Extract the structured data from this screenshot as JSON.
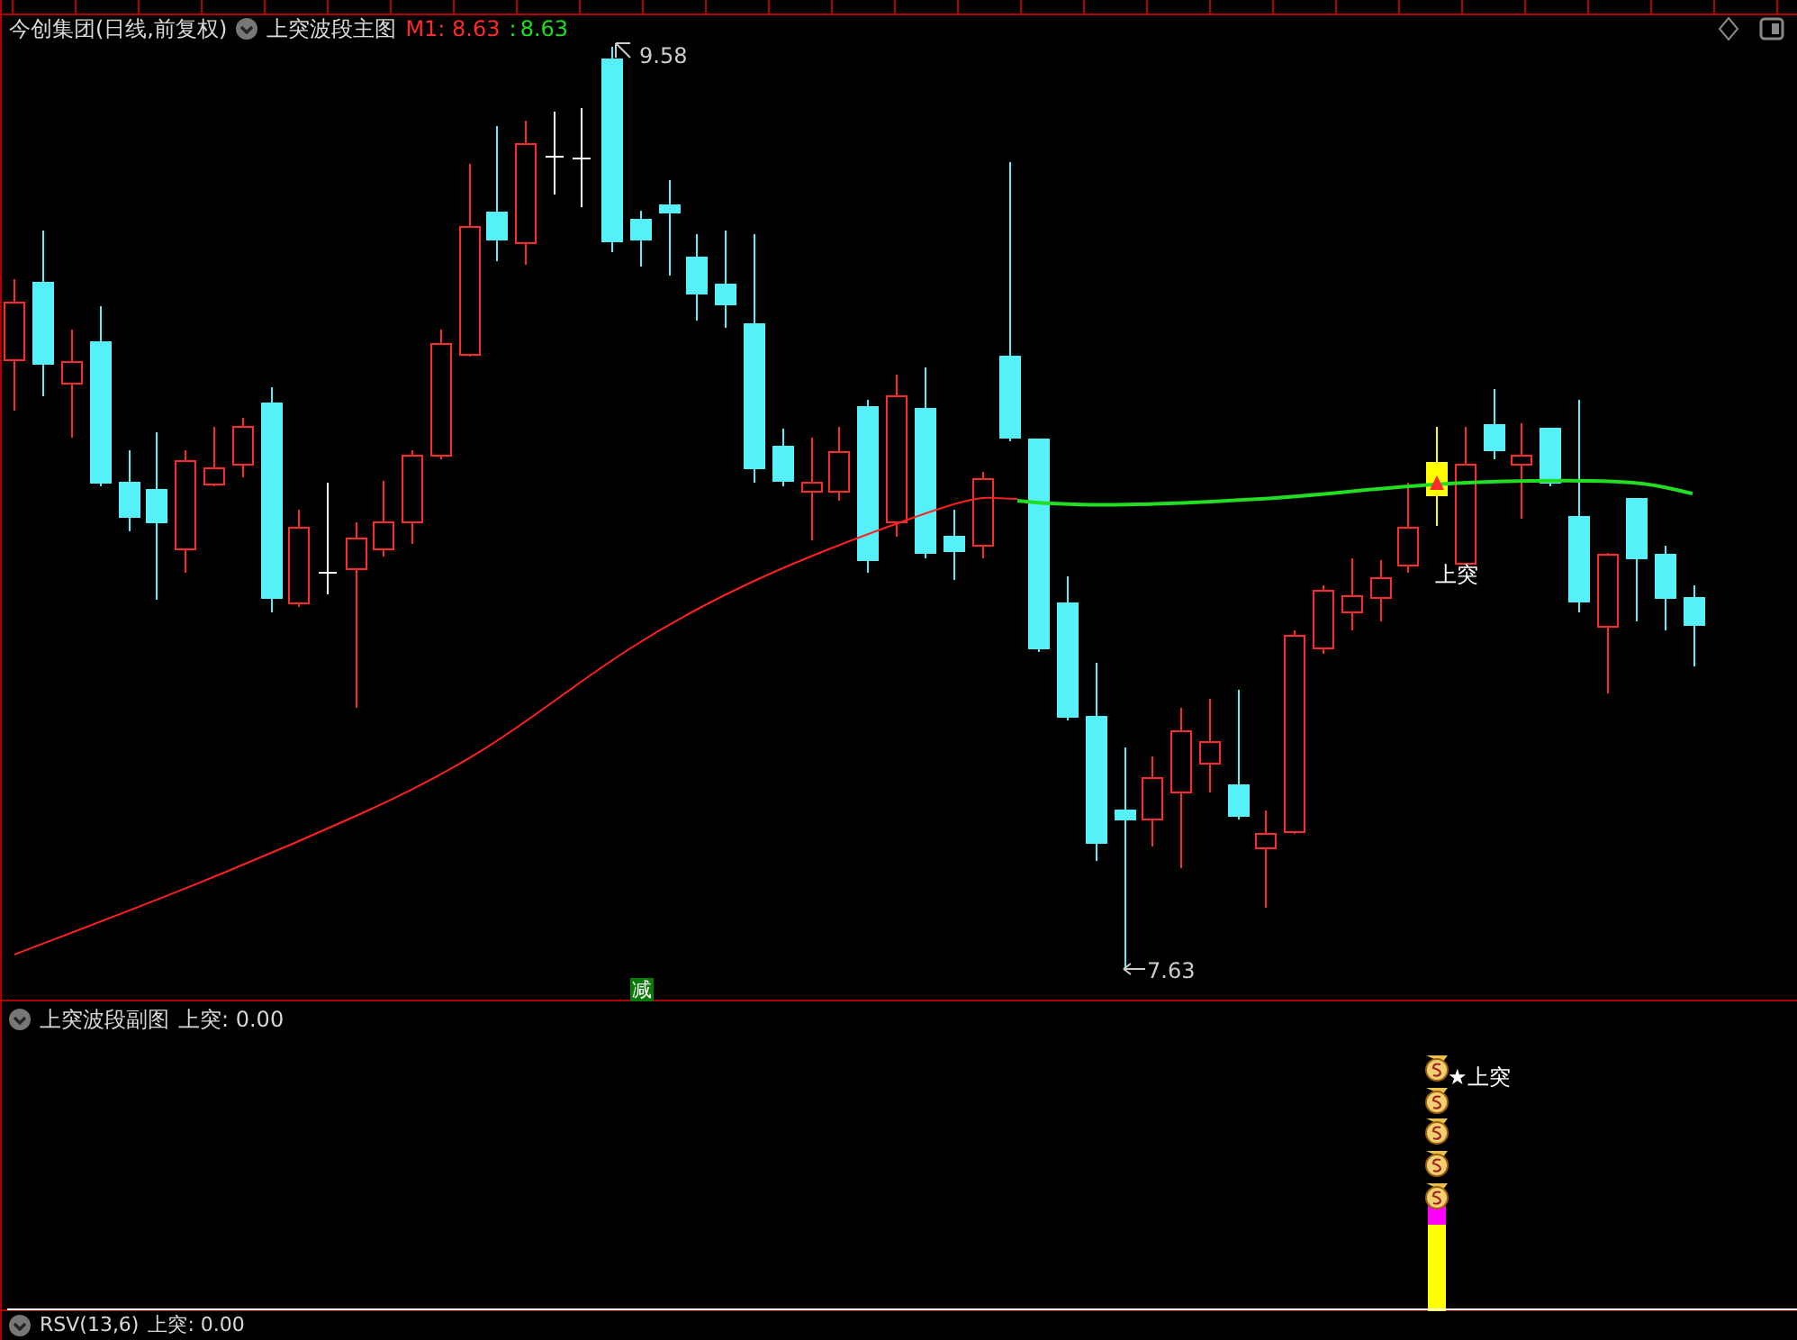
{
  "main_panel": {
    "title": "今创集团(日线,前复权)",
    "indicator": "上突波段主图",
    "m1_label": "M1:",
    "m1_value": "8.63",
    "separator": ":",
    "value2": "8.63",
    "high_label": "9.58",
    "low_label": "7.63",
    "signal_label": "上突",
    "marker": "减"
  },
  "sub_panel": {
    "indicator": "上突波段副图",
    "reading": "上突: 0.00",
    "signal_label": "★上突"
  },
  "bottom_panel": {
    "indicator": "RSV(13,6)",
    "reading": "上突: 0.00"
  }
}
